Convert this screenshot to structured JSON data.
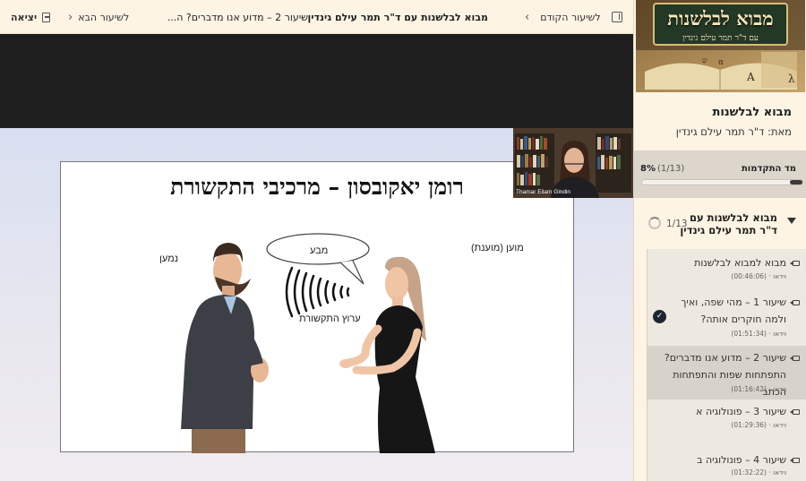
{
  "topbar": {
    "course_title": "מבוא לבלשנות עם ד\"ר תמר עילם גינדין",
    "separator": "-",
    "lesson_title": "שיעור 2 – מדוע אנו מדברים? ה...",
    "prev_label": "לשיעור הקודם",
    "next_label": "לשיעור הבא",
    "exit_label": "יציאה"
  },
  "video": {
    "slide_title": "רומן יאקובסון – מרכיבי התקשורת",
    "label_sender": "מוען (מוענת)",
    "label_receiver": "נמען",
    "label_message": "מבע",
    "label_channel": "ערוץ התקשורת",
    "webcam_name": "Thamar Eilam Gindin"
  },
  "sidebar": {
    "banner_title": "מבוא לבלשנות",
    "banner_subtitle": "עם ד\"ר תמר עילם גינדין",
    "course_name": "מבוא לבלשנות",
    "author": "מאת: ד\"ר תמר עילם גינדין",
    "progress": {
      "label": "מד התקדמות",
      "count": "(1/13)",
      "percent_text": "8%",
      "fraction": 0.08
    },
    "section": {
      "title": "מבוא לבלשנות עם ד\"ר תמר עילם גינדין",
      "count": "1/13"
    },
    "lessons": [
      {
        "title": "מבוא למבוא לבלשנות",
        "type": "וידאו",
        "duration": "(00:46:06)",
        "completed": false,
        "active": false
      },
      {
        "title": "שיעור 1 – מהי שפה, ואיך ולמה חוקרים אותה?",
        "type": "וידאו",
        "duration": "(01:51:34)",
        "completed": true,
        "active": false
      },
      {
        "title": "שיעור 2 – מדוע אנו מדברים? התפתחות שפות והתפתחות הכתב",
        "type": "וידאו",
        "duration": "(01:16:42)",
        "completed": false,
        "active": true
      },
      {
        "title": "שיעור 3 – פונולוגיה א",
        "type": "וידאו",
        "duration": "(01:29:36)",
        "completed": false,
        "active": false
      },
      {
        "title": "שיעור 4 – פונולוגיה ב",
        "type": "וידאו",
        "duration": "(01:32:22)",
        "completed": false,
        "active": false
      }
    ]
  }
}
